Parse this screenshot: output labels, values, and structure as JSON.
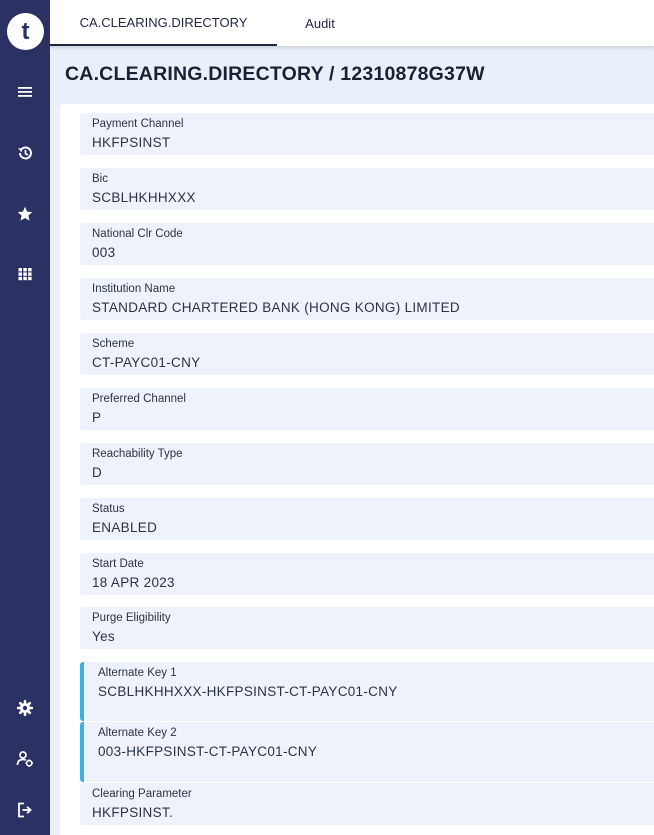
{
  "sidebar": {
    "logo_letter": "t",
    "items": [
      {
        "name": "menu-icon"
      },
      {
        "name": "history-icon"
      },
      {
        "name": "star-icon"
      },
      {
        "name": "grid-icon"
      },
      {
        "name": "gear-icon"
      },
      {
        "name": "user-settings-icon"
      },
      {
        "name": "logout-icon"
      }
    ],
    "bg_color": "#2b3263"
  },
  "tabs": [
    {
      "label": "CA.CLEARING.DIRECTORY",
      "active": true
    },
    {
      "label": "Audit",
      "active": false
    }
  ],
  "page": {
    "title": "CA.CLEARING.DIRECTORY / 12310878G37W"
  },
  "fields": [
    {
      "label": "Payment Channel",
      "value": "HKFPSINST"
    },
    {
      "label": "Bic",
      "value": "SCBLHKHHXXX"
    },
    {
      "label": "National Clr Code",
      "value": "003"
    },
    {
      "label": "Institution Name",
      "value": "STANDARD CHARTERED BANK (HONG KONG) LIMITED"
    },
    {
      "label": "Scheme",
      "value": "CT-PAYC01-CNY"
    },
    {
      "label": "Preferred Channel",
      "value": "P"
    },
    {
      "label": "Reachability Type",
      "value": "D"
    },
    {
      "label": "Status",
      "value": "ENABLED"
    },
    {
      "label": "Start Date",
      "value": "18 APR 2023"
    },
    {
      "label": "Purge Eligibility",
      "value": "Yes"
    },
    {
      "label": "Alternate Key 1",
      "value": "SCBLHKHHXXX-HKFPSINST-CT-PAYC01-CNY"
    },
    {
      "label": "Alternate Key 2",
      "value": "003-HKFPSINST-CT-PAYC01-CNY"
    },
    {
      "label": "Clearing Parameter",
      "value": "HKFPSINST."
    }
  ],
  "colors": {
    "accent": "#3ab0e4",
    "field_bg": "#eef3fb",
    "main_bg": "#e9f0f9"
  }
}
